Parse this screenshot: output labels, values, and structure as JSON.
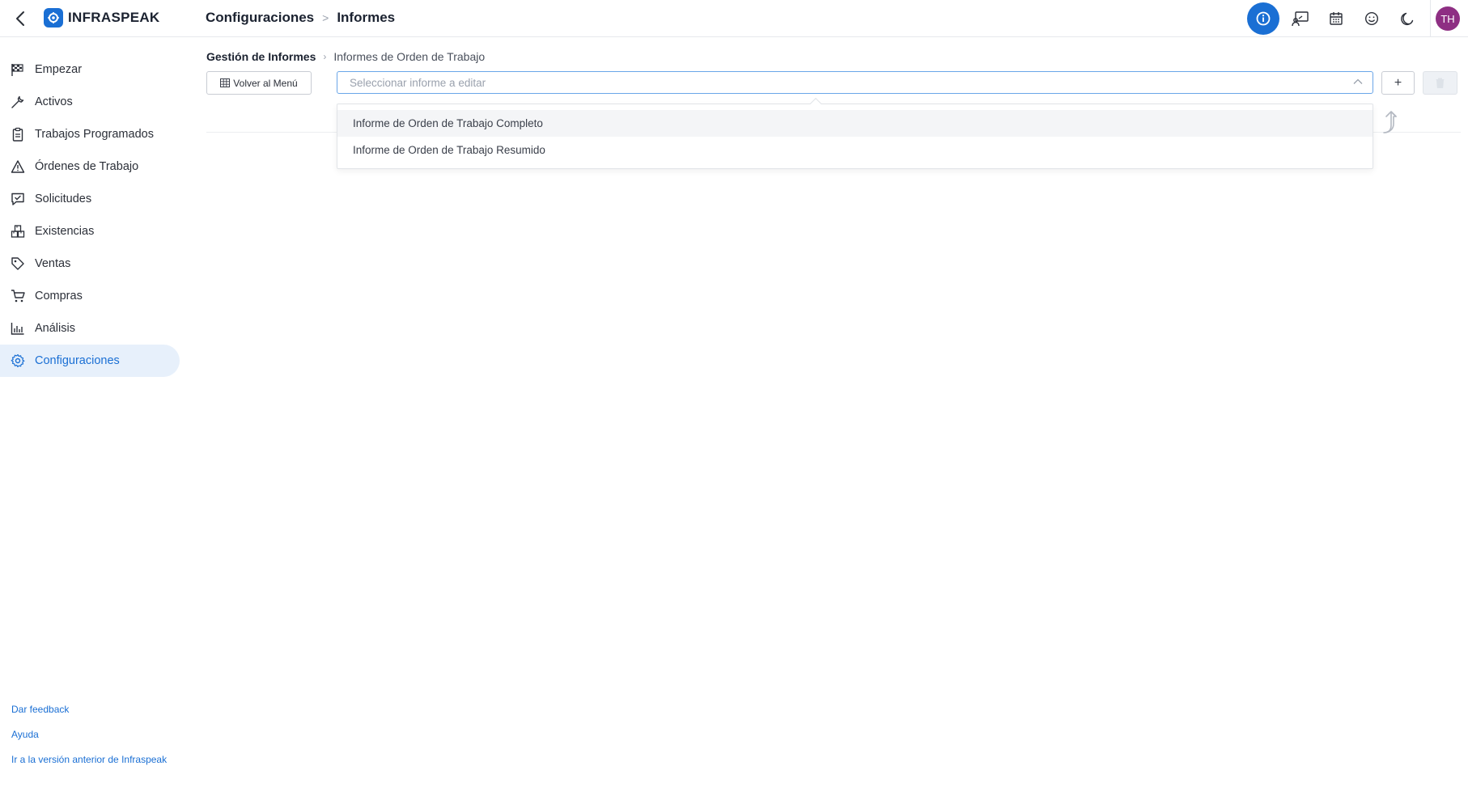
{
  "app": {
    "name": "INFRASPEAK",
    "accent": "#1a6fd4",
    "avatar_color": "#8e2f83"
  },
  "topbar": {
    "section": "Configuraciones",
    "separator": ">",
    "page": "Informes",
    "icons": [
      "info-icon",
      "whiteboard-icon",
      "calendar-icon",
      "smiley-icon",
      "moon-icon"
    ],
    "avatar_initials": "TH"
  },
  "sidebar": {
    "items": [
      {
        "label": "Empezar",
        "icon": "flag-icon"
      },
      {
        "label": "Activos",
        "icon": "wrench-icon"
      },
      {
        "label": "Trabajos Programados",
        "icon": "clipboard-icon"
      },
      {
        "label": "Órdenes de Trabajo",
        "icon": "warning-icon"
      },
      {
        "label": "Solicitudes",
        "icon": "chat-check-icon"
      },
      {
        "label": "Existencias",
        "icon": "boxes-icon"
      },
      {
        "label": "Ventas",
        "icon": "tag-icon"
      },
      {
        "label": "Compras",
        "icon": "cart-icon"
      },
      {
        "label": "Análisis",
        "icon": "bar-chart-icon"
      },
      {
        "label": "Configuraciones",
        "icon": "gear-icon",
        "active": true
      }
    ],
    "footer": {
      "feedback": "Dar feedback",
      "help": "Ayuda",
      "old_version": "Ir a la versión anterior de Infraspeak"
    }
  },
  "main": {
    "breadcrumb": {
      "parent": "Gestión de Informes",
      "current": "Informes de Orden de Trabajo"
    },
    "back_button": "Volver al Menú",
    "select": {
      "placeholder": "Seleccionar informe a editar"
    },
    "add_button": "+",
    "hint_fragment": "ui",
    "dropdown_options": [
      "Informe de Orden de Trabajo Completo",
      "Informe de Orden de Trabajo Resumido"
    ]
  }
}
